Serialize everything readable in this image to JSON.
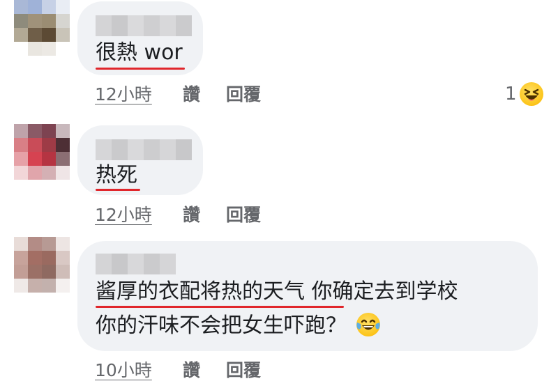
{
  "comments": [
    {
      "text": "很熱 wor",
      "time": "12小時",
      "like_label": "讚",
      "reply_label": "回覆",
      "reaction": {
        "count": "1",
        "icon": "laughing-squint-emoji"
      }
    },
    {
      "text": "热死",
      "time": "12小時",
      "like_label": "讚",
      "reply_label": "回覆"
    },
    {
      "text_line1_underlined": "酱厚的衣配将热的天气",
      "text_line1_rest": " 你确定去到学校",
      "text_line2": "你的汗味不会把女生吓跑？",
      "text_emoji": "tears-of-joy-emoji",
      "time": "10小時",
      "like_label": "讚",
      "reply_label": "回覆"
    }
  ],
  "colors": {
    "bubble_bg": "#f0f2f5",
    "text": "#1c1e21",
    "meta_text": "#65676b",
    "underline": "#e0262b",
    "emoji_yellow": "#fcc419"
  }
}
